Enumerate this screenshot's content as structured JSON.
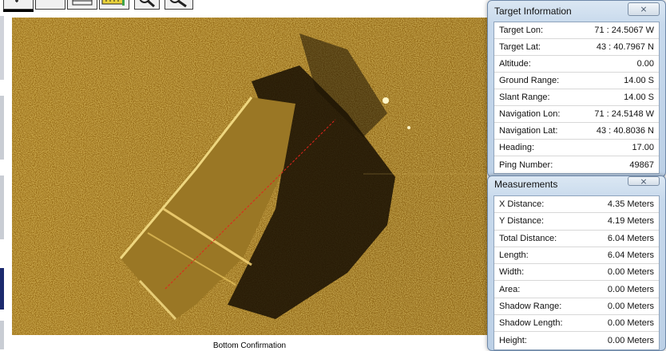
{
  "caption": "Bottom Confirmation",
  "target_info": {
    "title": "Target Information",
    "close_glyph": "⨯",
    "rows": [
      {
        "label": "Target Lon:",
        "value": "71 : 24.5067 W"
      },
      {
        "label": "Target Lat:",
        "value": "43 : 40.7967 N"
      },
      {
        "label": "Altitude:",
        "value": "0.00"
      },
      {
        "label": "Ground Range:",
        "value": "14.00 S"
      },
      {
        "label": "Slant Range:",
        "value": "14.00 S"
      },
      {
        "label": "Navigation Lon:",
        "value": "71 : 24.5148 W"
      },
      {
        "label": "Navigation Lat:",
        "value": "43 : 40.8036 N"
      },
      {
        "label": "Heading:",
        "value": "17.00"
      },
      {
        "label": "Ping Number:",
        "value": "49867"
      }
    ]
  },
  "measurements": {
    "title": "Measurements",
    "close_glyph": "⨯",
    "rows": [
      {
        "label": "X Distance:",
        "value": "4.35 Meters"
      },
      {
        "label": "Y Distance:",
        "value": "4.19 Meters"
      },
      {
        "label": "Total Distance:",
        "value": "6.04 Meters"
      },
      {
        "label": "Length:",
        "value": "6.04 Meters"
      },
      {
        "label": "Width:",
        "value": "0.00 Meters"
      },
      {
        "label": "Area:",
        "value": "0.00 Meters"
      },
      {
        "label": "Shadow Range:",
        "value": "0.00 Meters"
      },
      {
        "label": "Shadow Length:",
        "value": "0.00 Meters"
      },
      {
        "label": "Height:",
        "value": "0.00 Meters"
      }
    ]
  },
  "colors": {
    "sonar_bright": "#e6b53a",
    "sonar_dark": "#2a1c04",
    "measure_line": "#e0241c",
    "left_strip_accent": "#1c2a6e"
  },
  "icons": [
    "cursor-tool-icon",
    "window-tool-icon",
    "ruler-icon",
    "zoom-in-icon",
    "zoom-out-icon"
  ]
}
